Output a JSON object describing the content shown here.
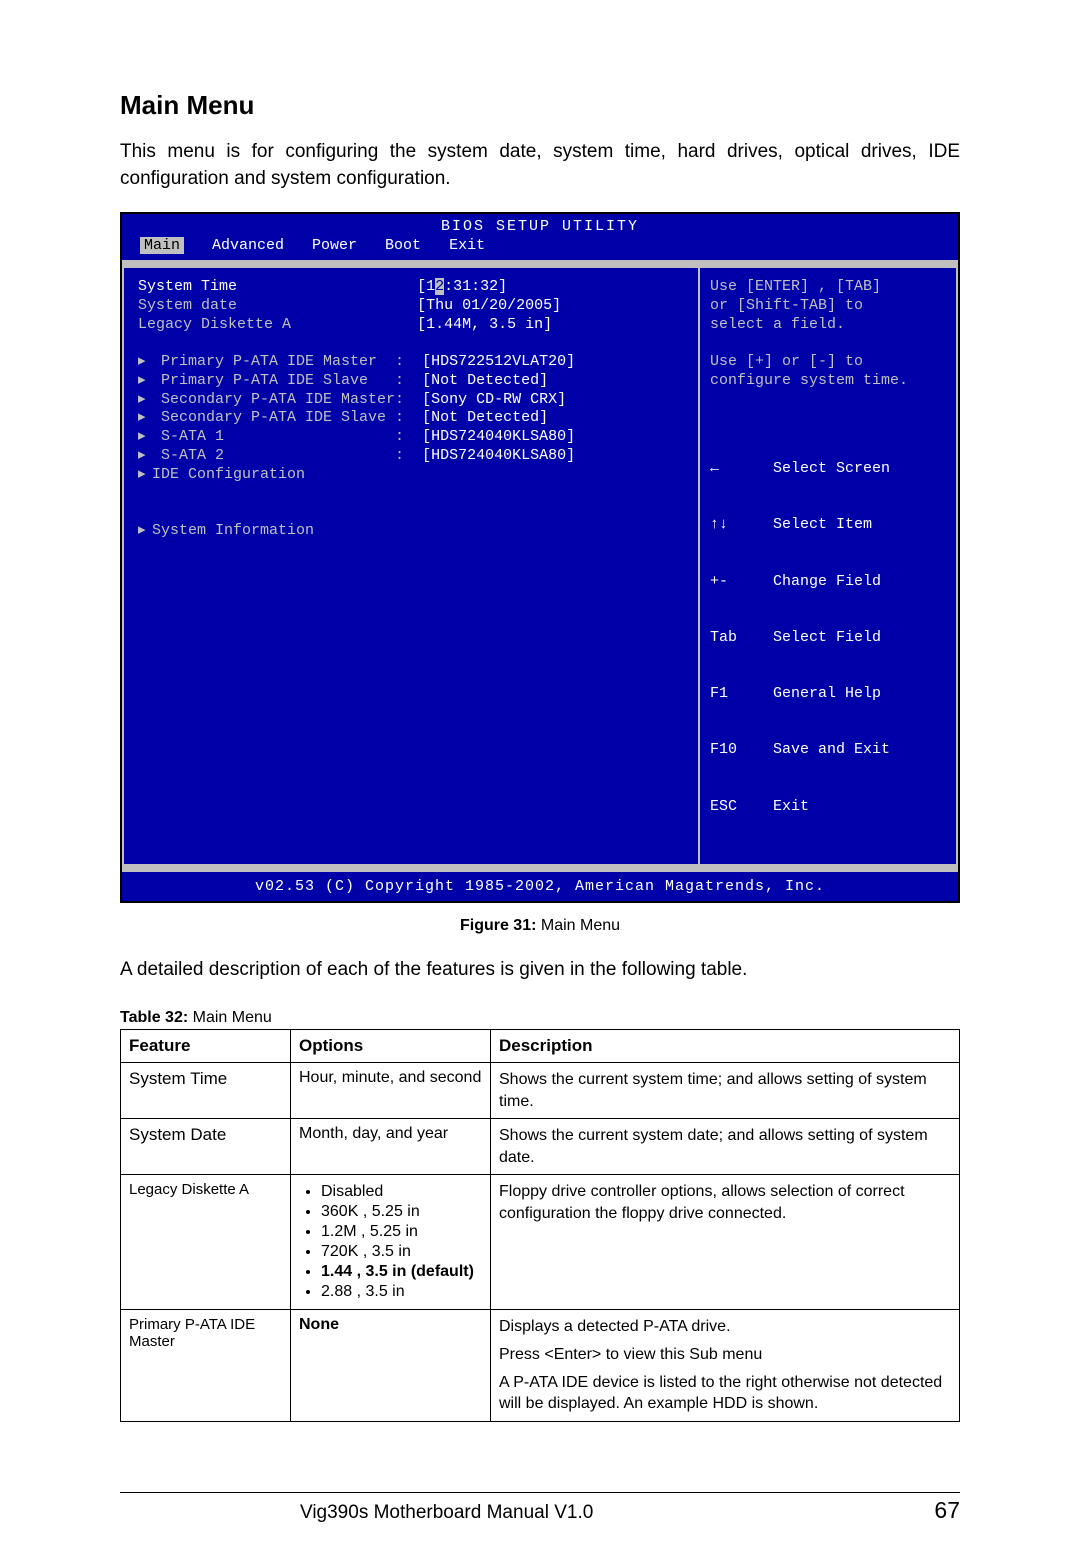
{
  "heading": "Main Menu",
  "intro": "This menu is for configuring the system date, system time, hard drives, optical drives, IDE configuration and system configuration.",
  "bios": {
    "title": "BIOS SETUP UTILITY",
    "tabs": [
      "Main",
      "Advanced",
      "Power",
      "Boot",
      "Exit"
    ],
    "selected_tab": 0,
    "left": {
      "sys_time_label": "System Time",
      "sys_time_prefix": "[1",
      "sys_time_highlight": "2",
      "sys_time_rest": ":31:32]",
      "sys_date_label": "System date",
      "sys_date_value": "[Thu 01/20/2005]",
      "legacy_label": "Legacy Diskette A",
      "legacy_value": "[1.44M, 3.5 in]",
      "rows": [
        {
          "label": "Primary P-ATA IDE Master  :",
          "value": "[HDS722512VLAT20]"
        },
        {
          "label": "Primary P-ATA IDE Slave   :",
          "value": "[Not Detected]"
        },
        {
          "label": "Secondary P-ATA IDE Master:",
          "value": "[Sony CD-RW CRX]"
        },
        {
          "label": "Secondary P-ATA IDE Slave :",
          "value": "[Not Detected]"
        },
        {
          "label": "S-ATA 1                   :",
          "value": "[HDS724040KLSA80]"
        },
        {
          "label": "S-ATA 2                   :",
          "value": "[HDS724040KLSA80]"
        }
      ],
      "ide_conf": "IDE Configuration",
      "sys_info": "System Information"
    },
    "right": {
      "help1": "Use [ENTER] , [TAB]",
      "help2": "or [Shift-TAB] to",
      "help3": "select a field.",
      "help4": "Use [+] or [-] to",
      "help5": "configure system time.",
      "keys": [
        "←      Select Screen",
        "↑↓     Select Item",
        "+-     Change Field",
        "Tab    Select Field",
        "F1     General Help",
        "F10    Save and Exit",
        "ESC    Exit"
      ]
    },
    "footer": "v02.53 (C) Copyright 1985-2002, American Magatrends, Inc."
  },
  "figure_caption_bold": "Figure 31:",
  "figure_caption_rest": " Main Menu",
  "desc_text": "A detailed description of each of the features is given in the following table.",
  "table_caption_bold": "Table 32: ",
  "table_caption_rest": "Main Menu",
  "table": {
    "headers": [
      "Feature",
      "Options",
      "Description"
    ],
    "rows": [
      {
        "feature": "System Time",
        "options_plain": "Hour, minute, and second",
        "description": "Shows the current system time; and allows setting of system time."
      },
      {
        "feature": "System Date",
        "options_plain": "Month, day, and year",
        "description": "Shows the current system date; and allows setting of system date."
      },
      {
        "feature": "Legacy Diskette A",
        "options_list": [
          {
            "text": "Disabled"
          },
          {
            "text": "360K , 5.25 in"
          },
          {
            "text": "1.2M , 5.25 in"
          },
          {
            "text": "720K , 3.5 in"
          },
          {
            "text": "1.44 , 3.5 in (default)",
            "bold": true
          },
          {
            "text": "2.88 , 3.5 in"
          }
        ],
        "description": "Floppy drive controller options, allows selection of correct configuration the floppy drive connected."
      },
      {
        "feature": "Primary P-ATA IDE Master",
        "options_bold": "None",
        "desc_p1": "Displays a detected P-ATA drive.",
        "desc_p2": "Press <Enter> to view this Sub menu",
        "desc_p3": "A P-ATA IDE device is listed to the right otherwise not detected will be displayed. An example HDD is shown."
      }
    ]
  },
  "footer_title": "Vig390s Motherboard Manual V1.0",
  "footer_page": "67"
}
